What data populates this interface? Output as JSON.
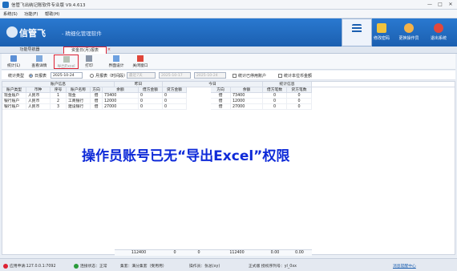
{
  "window": {
    "title": "信管飞出纳记账软件专业版 V9.4.613",
    "minimize": "—",
    "maximize": "□",
    "close": "✕"
  },
  "menu": [
    "系统(S)",
    "功能(F)",
    "帮助(H)"
  ],
  "banner": {
    "logo": "信管飞",
    "subtitle": "- 精细化管理软件",
    "buttons": [
      {
        "label": "",
        "icon": "grid-menu-icon"
      },
      {
        "label": "修改密码",
        "icon": "lock-icon"
      },
      {
        "label": "更换操作员",
        "icon": "user-icon"
      },
      {
        "label": "退出系统",
        "icon": "power-icon"
      }
    ]
  },
  "tabs": [
    {
      "label": "功能导航器",
      "active": false
    },
    {
      "label": "资金日(月)报表",
      "active": true,
      "close": "×"
    }
  ],
  "toolbar": [
    {
      "label": "统计(L)",
      "icon": "refresh-icon",
      "disabled": false
    },
    {
      "label": "查看详情",
      "icon": "detail-icon",
      "disabled": false
    },
    {
      "label": "导出Excel",
      "icon": "excel-export-icon",
      "disabled": true
    },
    {
      "label": "打印",
      "icon": "print-icon",
      "disabled": false
    },
    {
      "label": "界面设计",
      "icon": "design-icon",
      "disabled": false
    },
    {
      "label": "关闭窗口",
      "icon": "close-window-icon",
      "disabled": false
    }
  ],
  "filter": {
    "stat_type_label": "统计类型",
    "daily_label": "日报表",
    "daily_date": "2025-10-24",
    "monthly_label": "月报表（时间段）",
    "month_from": "2025-10-17",
    "month_to": "2025-10-24",
    "month_select": "最近7天",
    "disabled_accounts_label": "统计已停用账户",
    "base_currency_label": "统计本位币金额"
  },
  "grid": {
    "group_headers": {
      "account_info": "账户信息",
      "yesterday": "昨日",
      "today": "今日",
      "stats": "统计信息"
    },
    "columns": [
      "账户类型",
      "币种",
      "序号",
      "账户名称",
      "方向",
      "余额",
      "借方金额",
      "贷方金额",
      "方向",
      "余额",
      "借方笔数",
      "贷方笔数"
    ],
    "rows": [
      [
        "现金账户",
        "人民币",
        "1",
        "现金",
        "借",
        "73400",
        "0",
        "0",
        "借",
        "73400",
        "0",
        "0"
      ],
      [
        "银行账户",
        "人民币",
        "2",
        "工商银行",
        "借",
        "12000",
        "0",
        "0",
        "借",
        "12000",
        "0",
        "0"
      ],
      [
        "银行账户",
        "人民币",
        "3",
        "建设银行",
        "借",
        "27000",
        "0",
        "0",
        "借",
        "27000",
        "0",
        "0"
      ]
    ],
    "totals": {
      "yesterday_balance": "112400",
      "debit": "0",
      "credit": "0",
      "today_balance": "112400",
      "debit_count": "0.00",
      "credit_count": "0.00"
    }
  },
  "annotation": "操作员账号已无“导出Excel”权限",
  "status": {
    "server": "应用申请:127.0.0.1:7092",
    "connection": "连接状态：正常",
    "company": "集套：满分集套（受用用）",
    "operator": "操作员：张总(xy)",
    "edition": "正式版  授权序列号：yl_0xx",
    "feedback": "消息提醒中心"
  }
}
